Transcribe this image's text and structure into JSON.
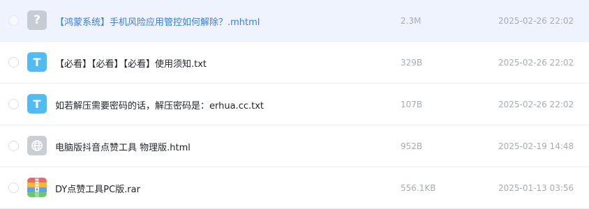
{
  "files": [
    {
      "name": "【鸿蒙系统】手机风险应用管控如何解除？.mhtml",
      "size": "2.3M",
      "date": "2025-02-26 22:02",
      "icon": "unknown-file-icon",
      "icon_glyph": "?",
      "selected": true
    },
    {
      "name": "【必看】【必看】【必看】使用须知.txt",
      "size": "329B",
      "date": "2025-02-26 22:02",
      "icon": "text-file-icon",
      "icon_glyph": "T",
      "selected": false
    },
    {
      "name": "如若解压需要密码的话，解压密码是：erhua.cc.txt",
      "size": "107B",
      "date": "2025-02-26 22:02",
      "icon": "text-file-icon",
      "icon_glyph": "T",
      "selected": false
    },
    {
      "name": "电脑版抖音点赞工具 物理版.html",
      "size": "952B",
      "date": "2025-02-19 14:48",
      "icon": "web-file-icon",
      "icon_glyph": "",
      "selected": false
    },
    {
      "name": "DY点赞工具PC版.rar",
      "size": "556.1KB",
      "date": "2025-01-13 03:56",
      "icon": "archive-file-icon",
      "icon_glyph": "",
      "selected": false
    }
  ],
  "colors": {
    "selected_bg": "#eef3fd",
    "selected_text": "#3a7cf0",
    "text_icon": "#51bcf3",
    "muted_text": "#a6acb5"
  }
}
